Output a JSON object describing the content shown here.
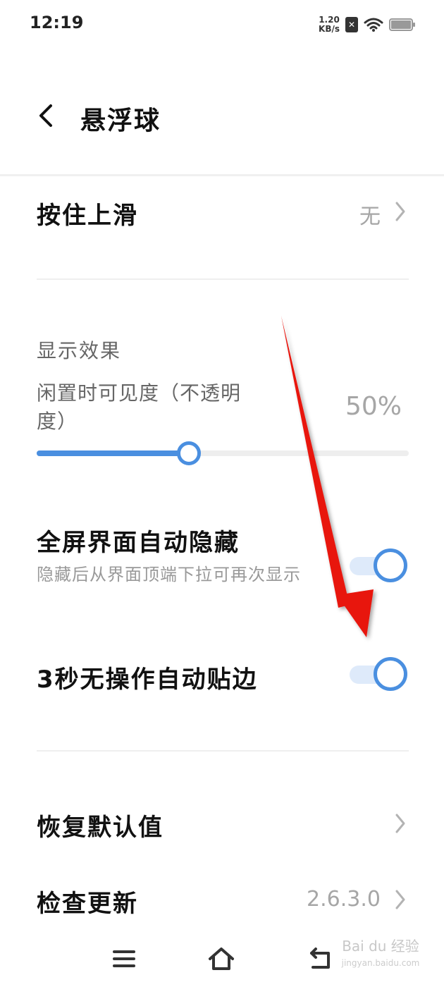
{
  "status_bar": {
    "time": "12:19",
    "net_speed_value": "1.20",
    "net_speed_unit": "KB/s",
    "icons": [
      "sim-x-icon",
      "wifi-icon",
      "battery-icon"
    ]
  },
  "header": {
    "title": "悬浮球",
    "back_icon": "chevron-left-icon"
  },
  "rows": {
    "swipe_up": {
      "label": "按住上滑",
      "value": "无"
    },
    "reset": {
      "label": "恢复默认值"
    },
    "check_update": {
      "label": "检查更新",
      "value": "2.6.3.0"
    }
  },
  "display": {
    "section_title": "显示效果",
    "opacity_label": "闲置时可见度（不透明度）",
    "opacity_value": "50%",
    "opacity_level": 0.41
  },
  "toggles": {
    "fullscreen_hide": {
      "label": "全屏界面自动隐藏",
      "desc": "隐藏后从界面顶端下拉可再次显示",
      "on": true
    },
    "auto_edge": {
      "label": "3秒无操作自动贴边",
      "on": true
    }
  },
  "nav_bar": {
    "icons": [
      "menu-icon",
      "home-icon",
      "back-icon"
    ]
  },
  "watermark": {
    "text": "Bai du 经验",
    "sub": "jingyan.baidu.com"
  },
  "colors": {
    "accent": "#4a8fe0",
    "toggle_track": "#deeafa",
    "arrow": "#e8140e",
    "secondary_text": "#a6a6a6"
  }
}
